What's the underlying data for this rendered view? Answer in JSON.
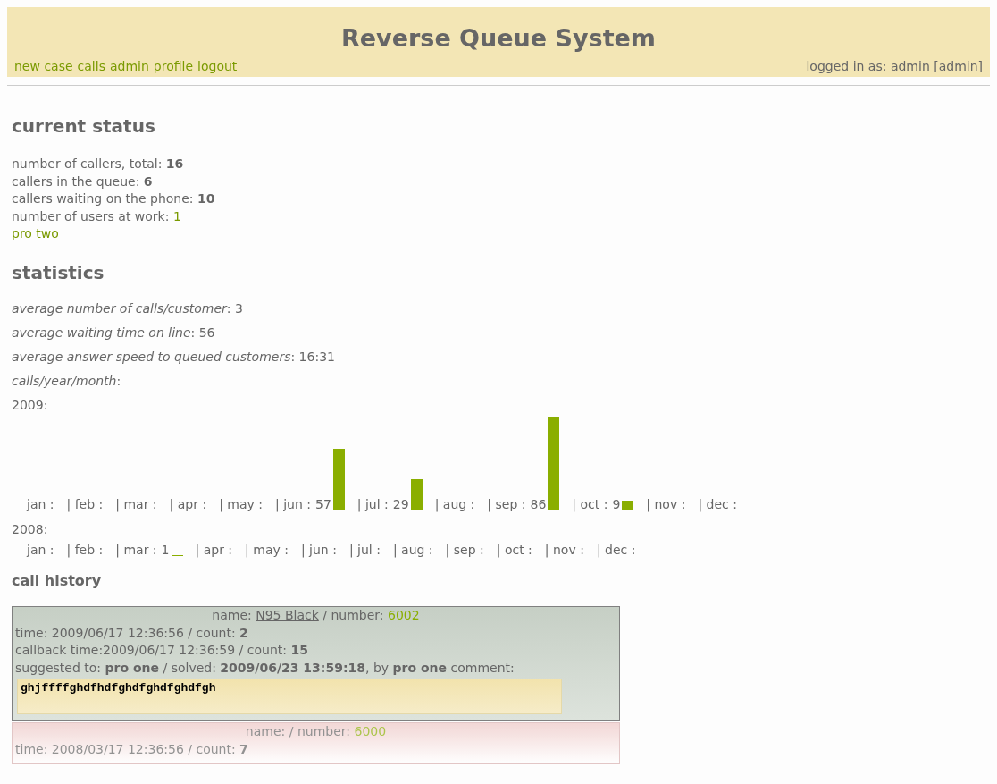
{
  "header": {
    "title": "Reverse Queue System",
    "nav": [
      "new case",
      "calls",
      "admin",
      "profile",
      "logout"
    ],
    "login": "logged in as: admin [admin]"
  },
  "current_status": {
    "heading": "current status",
    "lines": [
      {
        "label": "number of callers, total:",
        "value": "16",
        "kind": "bold"
      },
      {
        "label": "callers in the queue:",
        "value": "6",
        "kind": "bold"
      },
      {
        "label": "callers waiting on the phone:",
        "value": "10",
        "kind": "bold"
      },
      {
        "label": "number of users at work:",
        "value": "1",
        "kind": "link"
      }
    ],
    "users": [
      "pro two"
    ]
  },
  "statistics": {
    "heading": "statistics",
    "lines": [
      {
        "label": "average number of calls/customer",
        "value": ": 3"
      },
      {
        "label": "average waiting time on line",
        "value": ": 56"
      },
      {
        "label": "average answer speed to queued customers",
        "value": ": 16:31"
      },
      {
        "label": "calls/year/month",
        "value": ":"
      }
    ],
    "years": [
      {
        "year": "2009:",
        "months": [
          {
            "label": "jan :"
          },
          {
            "label": "| feb :"
          },
          {
            "label": "| mar :"
          },
          {
            "label": "| apr :"
          },
          {
            "label": "| may :"
          },
          {
            "label": "| jun :",
            "count": "57"
          },
          {
            "label": "| jul :",
            "count": "29"
          },
          {
            "label": "| aug :"
          },
          {
            "label": "| sep :",
            "count": "86"
          },
          {
            "label": "| oct :",
            "count": "9"
          },
          {
            "label": "| nov :"
          },
          {
            "label": "| dec :"
          }
        ]
      },
      {
        "year": "2008:",
        "months": [
          {
            "label": "jan :"
          },
          {
            "label": "| feb :"
          },
          {
            "label": "| mar :",
            "count": "1"
          },
          {
            "label": "| apr :"
          },
          {
            "label": "| may :"
          },
          {
            "label": "| jun :"
          },
          {
            "label": "| jul :"
          },
          {
            "label": "| aug :"
          },
          {
            "label": "| sep :"
          },
          {
            "label": "| oct :"
          },
          {
            "label": "| nov :"
          },
          {
            "label": "| dec :"
          }
        ]
      }
    ]
  },
  "call_history": {
    "heading": "call history",
    "cards": [
      {
        "kind": "solved",
        "name_label": "name:",
        "name": "N95 Black",
        "number_label": "/ number:",
        "number": "6002",
        "lines": [
          "time: 2009/06/17 12:36:56 / count: **2**",
          "callback time:2009/06/17 12:36:59 / count: **15**",
          "suggested to: **pro one** / solved: **2009/06/23 13:59:18**, by **pro one** comment:"
        ],
        "comment": "ghjffffghdfhdfghdfghdfghdfgh"
      },
      {
        "kind": "open",
        "name_label": "name: /",
        "number_label": "number:",
        "number": "6000",
        "lines": [
          "time: 2008/03/17 12:36:56 / count: **7**"
        ]
      }
    ]
  }
}
